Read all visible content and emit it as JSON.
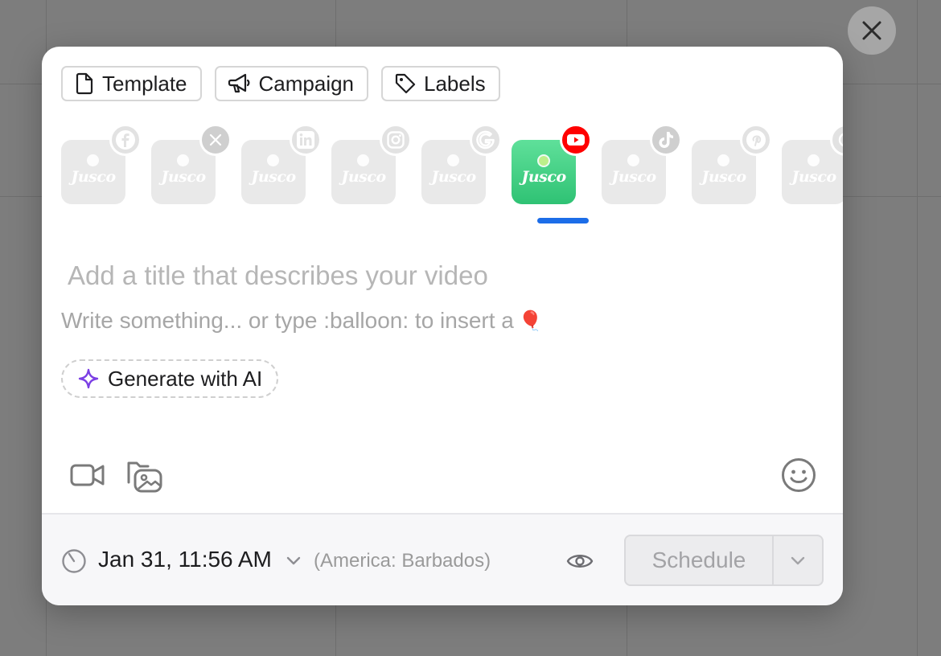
{
  "toolbar": {
    "template_label": "Template",
    "campaign_label": "Campaign",
    "labels_label": "Labels"
  },
  "profiles": [
    {
      "network": "facebook",
      "logo_text": "Jusco",
      "active": false
    },
    {
      "network": "x",
      "logo_text": "Jusco",
      "active": false
    },
    {
      "network": "linkedin",
      "logo_text": "Jusco",
      "active": false
    },
    {
      "network": "instagram",
      "logo_text": "Jusco",
      "active": false
    },
    {
      "network": "google",
      "logo_text": "Jusco",
      "active": false
    },
    {
      "network": "youtube",
      "logo_text": "Jusco",
      "active": true
    },
    {
      "network": "tiktok",
      "logo_text": "Jusco",
      "active": false
    },
    {
      "network": "pinterest",
      "logo_text": "Jusco",
      "active": false
    },
    {
      "network": "threads",
      "logo_text": "Jusco",
      "active": false
    }
  ],
  "editor": {
    "title_placeholder": "Add a title that describes your video",
    "body_placeholder": "Write something... or type :balloon: to insert a",
    "balloon_emoji": "🎈",
    "ai_button_label": "Generate with AI"
  },
  "footer": {
    "date_time": "Jan 31, 11:56 AM",
    "timezone": "(America: Barbados)",
    "schedule_label": "Schedule"
  },
  "colors": {
    "accent_blue": "#1c6de8",
    "brand_green": "#3dd281",
    "youtube_red": "#ff0000",
    "ai_purple": "#7b3fe4"
  }
}
